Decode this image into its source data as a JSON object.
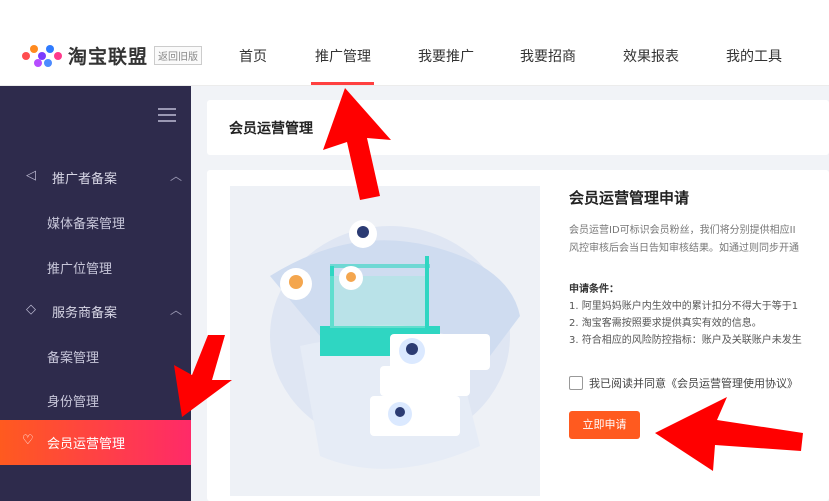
{
  "brand": {
    "name": "淘宝联盟",
    "old_version": "返回旧版"
  },
  "nav": [
    "首页",
    "推广管理",
    "我要推广",
    "我要招商",
    "效果报表",
    "我的工具"
  ],
  "sidebar": {
    "groups": [
      {
        "label": "推广者备案",
        "icon": "megaphone-icon",
        "items": [
          "媒体备案管理",
          "推广位管理"
        ]
      },
      {
        "label": "服务商备案",
        "icon": "handshake-icon",
        "items": [
          "备案管理",
          "身份管理"
        ]
      }
    ],
    "active": {
      "label": "会员运营管理",
      "icon": "diamond-heart-icon"
    }
  },
  "page_title": "会员运营管理",
  "apply": {
    "title": "会员运营管理申请",
    "desc_line1": "会员运营ID可标识会员粉丝，我们将分别提供相应II",
    "desc_line2": "风控审核后会当日告知审核结果。如通过则同步开通",
    "conditions_title": "申请条件：",
    "conditions": [
      "1. 阿里妈妈账户内生效中的累计扣分不得大于等于1",
      "2. 淘宝客需按照要求提供真实有效的信息。",
      "3. 符合相应的风险防控指标：账户及关联账户未发生"
    ],
    "agree_text": "我已阅读并同意《会员运营管理使用协议》",
    "button": "立即申请"
  },
  "colors": {
    "accent": "#ff5a1f",
    "sidebar": "#2e2b4c",
    "arrow": "#ff0000"
  }
}
